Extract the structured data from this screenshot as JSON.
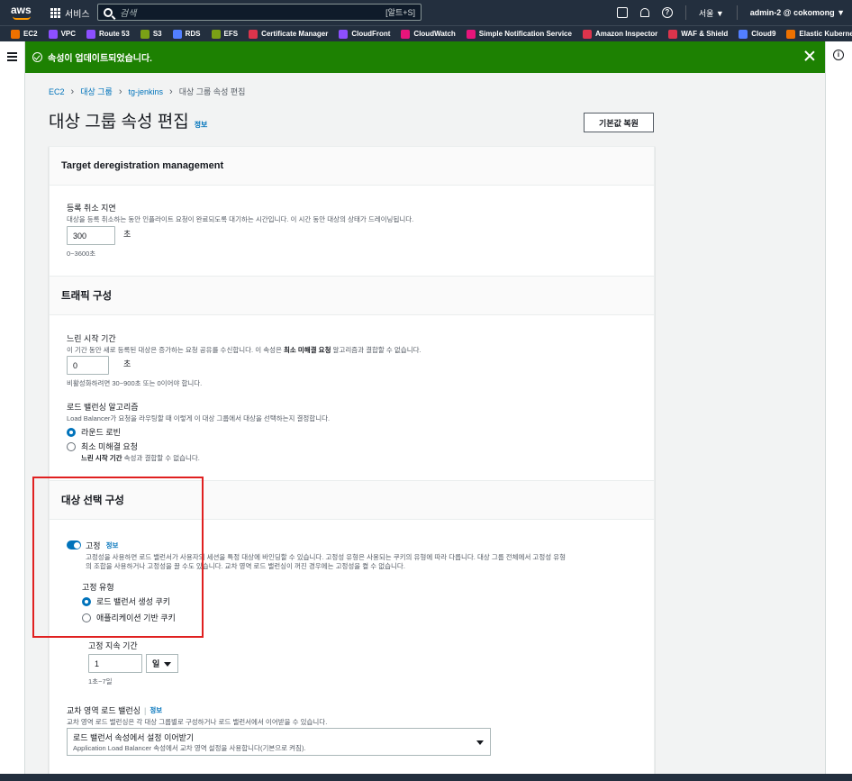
{
  "topnav": {
    "logo": "aws",
    "services_label": "서비스",
    "search_placeholder": "검색",
    "search_shortcut": "[알트+S]",
    "region": "서울 ▼",
    "account": "admin-2 @ cokomong ▼",
    "help_icon": "?"
  },
  "favorites": [
    {
      "label": "EC2",
      "color": "#ed7100"
    },
    {
      "label": "VPC",
      "color": "#8c4fff"
    },
    {
      "label": "Route 53",
      "color": "#8c4fff"
    },
    {
      "label": "S3",
      "color": "#7aa116"
    },
    {
      "label": "RDS",
      "color": "#527fff"
    },
    {
      "label": "EFS",
      "color": "#7aa116"
    },
    {
      "label": "Certificate Manager",
      "color": "#dd344c"
    },
    {
      "label": "CloudFront",
      "color": "#8c4fff"
    },
    {
      "label": "CloudWatch",
      "color": "#e7157b"
    },
    {
      "label": "Simple Notification Service",
      "color": "#e7157b"
    },
    {
      "label": "Amazon Inspector",
      "color": "#dd344c"
    },
    {
      "label": "WAF & Shield",
      "color": "#dd344c"
    },
    {
      "label": "Cloud9",
      "color": "#527fff"
    },
    {
      "label": "Elastic Kubernetes S",
      "color": "#ed7100"
    }
  ],
  "flash": {
    "message": "속성이 업데이트되었습니다."
  },
  "breadcrumb": [
    "EC2",
    "대상 그룹",
    "tg-jenkins",
    "대상 그룹 속성 편집"
  ],
  "page": {
    "title": "대상 그룹 속성 편집",
    "info": "정보",
    "reset_button": "기본값 복원"
  },
  "dereg": {
    "heading": "Target deregistration management",
    "label": "등록 취소 지연",
    "description": "대상을 등록 취소하는 동안 인플라이트 요청이 완료되도록 대기하는 시간입니다. 이 시간 동안 대상의 상태가 드레이닝됩니다.",
    "value": "300",
    "unit": "초",
    "hint": "0~3600초"
  },
  "traffic": {
    "heading": "트래픽 구성",
    "slowstart_label": "느린 시작 기간",
    "slowstart_desc_a": "이 기간 동안 새로 등록된 대상은 증가하는 요청 공유를 수신합니다. 이 속성은 ",
    "slowstart_desc_b": "최소 미해결 요청",
    "slowstart_desc_c": " 알고리즘과 결합할 수 없습니다.",
    "slowstart_value": "0",
    "slowstart_unit": "초",
    "slowstart_hint": "비활성화하려면 30~900초 또는 0이어야 합니다.",
    "algo_label": "로드 밸런싱 알고리즘",
    "algo_desc": "Load Balancer가 요청을 라우팅할 때 이렇게 이 대상 그룹에서 대상을 선택하는지 결정합니다.",
    "algo_opt1": "라운드 로빈",
    "algo_opt2": "최소 미해결 요청",
    "algo_opt2_desc_a": "느린 시작 기간",
    "algo_opt2_desc_b": " 속성과 결합할 수 없습니다."
  },
  "target": {
    "heading": "대상 선택 구성",
    "sticky_label": "고정",
    "sticky_info": "정보",
    "sticky_desc1": "고정성을 사용하면 로드 밸런서가 사용자의 세션을 특정 대상에 바인딩할 수 있습니다. 고정성 유형은 사용되는 쿠키의 유형에 따라 다릅니다. 대상 그룹 전체에서 고정성 유형",
    "sticky_desc2": "의 조합을 사용하거나 고정성을 끌 수도 있습니다. 교차 영역 로드 밸런싱이 꺼진 경우에는 고정성을 켤 수 없습니다.",
    "type_label": "고정 유형",
    "type_opt1": "로드 밸런서 생성 쿠키",
    "type_opt2": "애플리케이션 기반 쿠키",
    "duration_label": "고정 지속 기간",
    "duration_value": "1",
    "duration_unit": "일",
    "duration_hint": "1초~7일",
    "cross_label": "교차 영역 로드 밸런싱",
    "cross_info": "정보",
    "cross_desc": "교차 영역 로드 밸런싱은 각 대상 그룹별로 구성하거나 로드 밸런서에서 이어받을 수 있습니다.",
    "cross_select": "로드 밸런서 속성에서 설정 이어받기",
    "cross_select_sub": "Application Load Balancer 속성에서 교차 영역 설정을 사용합니다(기본으로 켜짐)."
  }
}
